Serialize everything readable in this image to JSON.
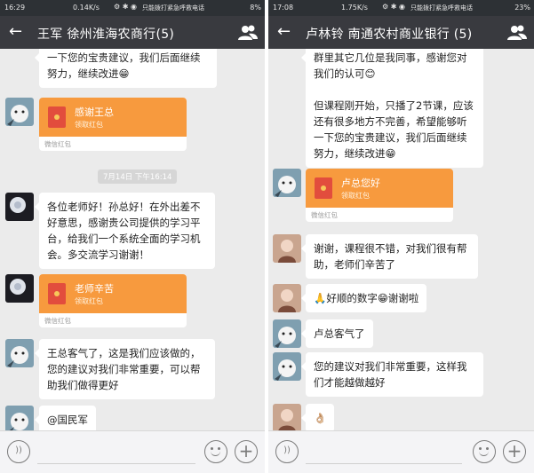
{
  "left": {
    "status": {
      "time": "16:29",
      "speed": "0.14K/s",
      "icons": "⚙ ✱ ◉",
      "carrier": "只能拨打紧急呼救电话",
      "battery": "8%"
    },
    "title": "王军  徐州淮海农商行(5)",
    "messages": {
      "m1": "一下您的宝贵建议，我们后面继续努力，继续改进😁",
      "rp1_title": "感谢王总",
      "rp1_sub": "领取红包",
      "rp1_foot": "微信红包",
      "timestamp": "7月14日 下午16:14",
      "m2": "各位老师好！孙总好！在外出差不好意思，感谢贵公司提供的学习平台，给我们一个系统全面的学习机会。多交流学习谢谢！",
      "rp2_title": "老师辛苦",
      "rp2_sub": "领取红包",
      "rp2_foot": "微信红包",
      "m3": "王总客气了，这是我们应该做的，您的建议对我们非常重要，可以帮助我们做得更好",
      "m4": "@国民军"
    }
  },
  "right": {
    "status": {
      "time": "17:08",
      "speed": "1.75K/s",
      "icons": "⚙ ✱ ◉",
      "carrier": "只能拨打紧急呼救电话",
      "battery": "23%"
    },
    "title": "卢林铃  南通农村商业银行 (5)",
    "messages": {
      "m1": "群里其它几位是我同事，感谢您对我们的认可😊\n\n但课程刚开始，只播了2节课，应该还有很多地方不完善，希望能够听一下您的宝贵建议，我们后面继续努力，继续改进😁",
      "rp1_title": "卢总您好",
      "rp1_sub": "领取红包",
      "rp1_foot": "微信红包",
      "m2": "谢谢，课程很不错，对我们很有帮助，老师们辛苦了",
      "m3": "🙏好顺的数字😁谢谢啦",
      "m4": "卢总客气了",
      "m5": "您的建议对我们非常重要，这样我们才能越做越好",
      "m6": "👌🏼"
    }
  },
  "input": {
    "voice_icon": "voice-icon",
    "emoji_icon": "emoji-icon",
    "plus_icon": "plus-icon"
  }
}
